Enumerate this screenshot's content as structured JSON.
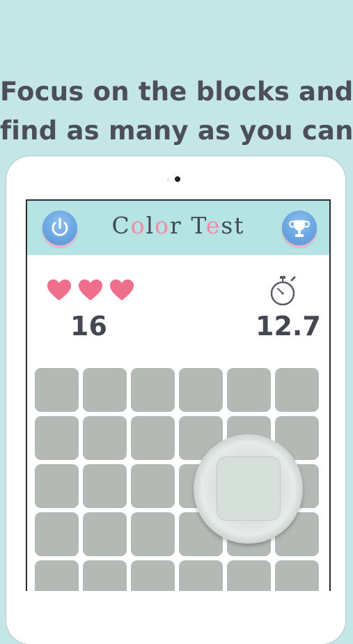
{
  "promo": {
    "line1": "Focus on the blocks and",
    "line2": "find as many as you can"
  },
  "header": {
    "title_parts": [
      {
        "text": "C",
        "pink": false
      },
      {
        "text": "o",
        "pink": true
      },
      {
        "text": "l",
        "pink": false
      },
      {
        "text": "o",
        "pink": true
      },
      {
        "text": "r",
        "pink": false
      },
      {
        "text": " ",
        "pink": false
      },
      {
        "text": "T",
        "pink": false
      },
      {
        "text": "e",
        "pink": true
      },
      {
        "text": "s",
        "pink": false
      },
      {
        "text": "t",
        "pink": false
      }
    ],
    "power_icon": "power-icon",
    "trophy_icon": "trophy-icon"
  },
  "status": {
    "lives": 3,
    "score": "16",
    "time": "12.7",
    "heart_icon": "heart-icon",
    "timer_icon": "stopwatch-icon"
  },
  "grid": {
    "columns": 6,
    "visible_rows": 5,
    "block_color": "#b5b9b6",
    "odd_block_color": "#d6e0db"
  },
  "colors": {
    "background": "#c4e6e6",
    "header_bg": "#b6e3e3",
    "button_blue": "#6aa6e2",
    "heart_pink": "#ef6e8c",
    "accent_pink": "#f08ca5",
    "text_dark": "#454852"
  }
}
